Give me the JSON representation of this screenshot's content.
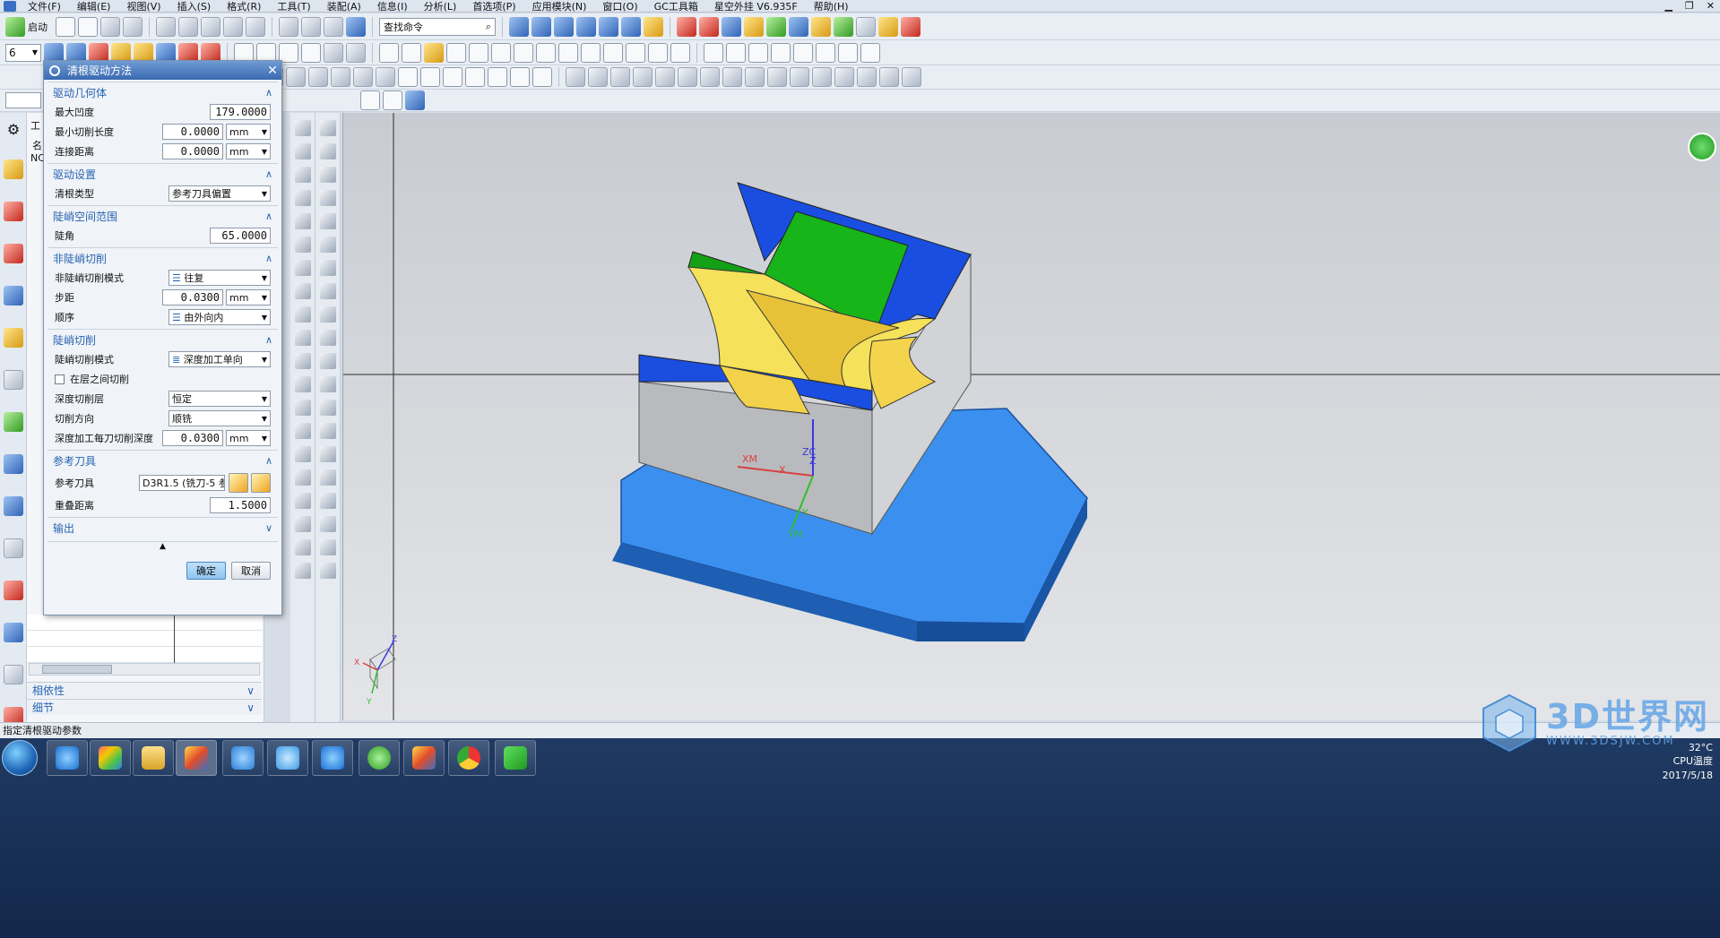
{
  "menu": [
    "文件(F)",
    "编辑(E)",
    "视图(V)",
    "插入(S)",
    "格式(R)",
    "工具(T)",
    "装配(A)",
    "信息(I)",
    "分析(L)",
    "首选项(P)",
    "应用模块(N)",
    "窗口(O)",
    "GC工具箱",
    "星空外挂 V6.935F",
    "帮助(H)"
  ],
  "toolbar": {
    "start_label": "启动",
    "search_placeholder": "查找命令",
    "layer_value": "6"
  },
  "navigator": {
    "partial1": "工",
    "partial2": "名",
    "partial3": "NC",
    "dependencies": "相依性",
    "details": "细节"
  },
  "dialog": {
    "title": "清根驱动方法",
    "drive_geometry": {
      "header": "驱动几何体",
      "max_concavity_label": "最大凹度",
      "max_concavity_value": "179.0000",
      "min_cut_length_label": "最小切削长度",
      "min_cut_length_value": "0.0000",
      "min_cut_length_unit": "mm",
      "link_distance_label": "连接距离",
      "link_distance_value": "0.0000",
      "link_distance_unit": "mm"
    },
    "drive_settings": {
      "header": "驱动设置",
      "cleanup_type_label": "清根类型",
      "cleanup_type_value": "参考刀具偏置"
    },
    "steep_range": {
      "header": "陡峭空间范围",
      "steep_angle_label": "陡角",
      "steep_angle_value": "65.0000"
    },
    "non_steep": {
      "header": "非陡峭切削",
      "pattern_label": "非陡峭切削模式",
      "pattern_value": "往复",
      "stepover_label": "步距",
      "stepover_value": "0.0300",
      "stepover_unit": "mm",
      "sequence_label": "顺序",
      "sequence_value": "由外向内"
    },
    "steep": {
      "header": "陡峭切削",
      "pattern_label": "陡峭切削模式",
      "pattern_value": "深度加工单向",
      "between_layers_label": "在层之间切削",
      "depth_levels_label": "深度切削层",
      "depth_levels_value": "恒定",
      "cut_direction_label": "切削方向",
      "cut_direction_value": "顺铣",
      "depth_per_cut_label": "深度加工每刀切削深度",
      "depth_per_cut_value": "0.0300",
      "depth_per_cut_unit": "mm"
    },
    "ref_tool": {
      "header": "参考刀具",
      "ref_tool_label": "参考刀具",
      "ref_tool_value": "D3R1.5 (铣刀-5 参",
      "overlap_label": "重叠距离",
      "overlap_value": "1.5000"
    },
    "output": {
      "header": "输出"
    },
    "ok_label": "确定",
    "cancel_label": "取消"
  },
  "status_text": "指定清根驱动参数",
  "viewport": {
    "axis_xm": "XM",
    "axis_ym": "YM",
    "axis_zc": "ZC",
    "axis_x": "X",
    "axis_y": "Y",
    "axis_z": "Z",
    "triad_x": "X",
    "triad_y": "Y",
    "triad_z": "Z"
  },
  "tray": {
    "cpu_label": "CPU温度",
    "temp": "32°C",
    "date": "2017/5/18"
  },
  "watermark": {
    "text": "3D世界网",
    "url": "WWW.3DSJW.COM"
  },
  "colors": {
    "face_blue": "#1a4ee0",
    "face_yellow": "#f5e15a",
    "face_green": "#17b41a",
    "face_gray": "#c9cacc",
    "base_blue": "#3b8fee",
    "accent": "#2764b3"
  }
}
